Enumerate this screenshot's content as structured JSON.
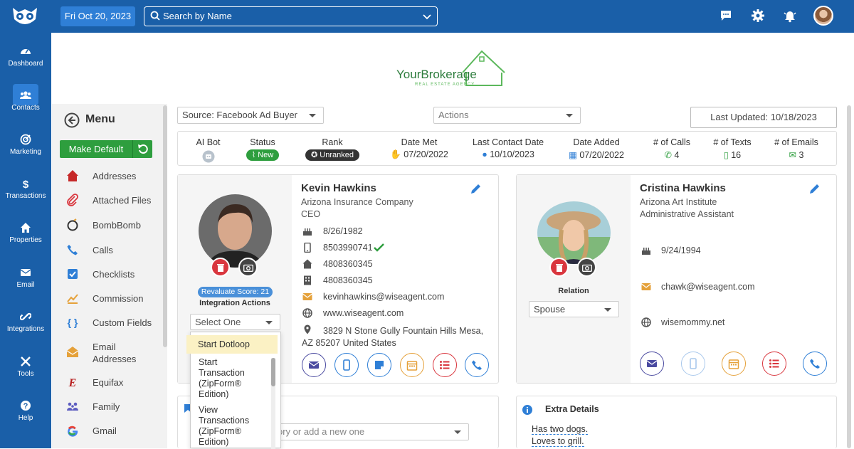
{
  "topbar": {
    "date": "Fri Oct 20, 2023",
    "search_placeholder": "Search by Name"
  },
  "nav": [
    {
      "label": "Dashboard",
      "icon": "gauge-icon"
    },
    {
      "label": "Contacts",
      "icon": "users-icon",
      "active": true
    },
    {
      "label": "Marketing",
      "icon": "marketing-icon"
    },
    {
      "label": "Transactions",
      "icon": "dollar-icon"
    },
    {
      "label": "Properties",
      "icon": "home-icon"
    },
    {
      "label": "Email",
      "icon": "envelope-icon"
    },
    {
      "label": "Integrations",
      "icon": "link-icon"
    },
    {
      "label": "Tools",
      "icon": "tools-icon"
    },
    {
      "label": "Help",
      "icon": "question-icon"
    }
  ],
  "brand": {
    "name": "YourBrokerage",
    "tagline": "REAL ESTATE AGENCY"
  },
  "menu": {
    "title": "Menu",
    "make_default": "Make Default",
    "items": [
      {
        "label": "Addresses",
        "icon": "house-icon"
      },
      {
        "label": "Attached Files",
        "icon": "paperclip-icon"
      },
      {
        "label": "BombBomb",
        "icon": "bombbomb-icon"
      },
      {
        "label": "Calls",
        "icon": "phone-icon"
      },
      {
        "label": "Checklists",
        "icon": "checkbox-icon"
      },
      {
        "label": "Commission",
        "icon": "chart-icon"
      },
      {
        "label": "Custom Fields",
        "icon": "braces-icon"
      },
      {
        "label": "Email Addresses",
        "line1": "Email",
        "line2": "Addresses",
        "icon": "envelope-open-icon"
      },
      {
        "label": "Equifax",
        "icon": "equifax-icon"
      },
      {
        "label": "Family",
        "icon": "family-icon"
      },
      {
        "label": "Gmail",
        "icon": "google-icon"
      }
    ]
  },
  "toolbar": {
    "source": "Source: Facebook Ad Buyer",
    "actions": "Actions",
    "last_updated": "Last Updated: 10/18/2023"
  },
  "stats": {
    "ai_bot": {
      "label": "AI Bot"
    },
    "status": {
      "label": "Status",
      "value": "New",
      "color": "#2e9e3e"
    },
    "rank": {
      "label": "Rank",
      "value": "Unranked",
      "color": "#333333"
    },
    "date_met": {
      "label": "Date Met",
      "value": "07/20/2022"
    },
    "last_contact": {
      "label": "Last Contact Date",
      "value": "10/10/2023"
    },
    "date_added": {
      "label": "Date Added",
      "value": "07/20/2022"
    },
    "calls": {
      "label": "# of Calls",
      "value": "4"
    },
    "texts": {
      "label": "# of Texts",
      "value": "16"
    },
    "emails": {
      "label": "# of Emails",
      "value": "3"
    }
  },
  "contact1": {
    "name": "Kevin Hawkins",
    "company": "Arizona Insurance Company",
    "title": "CEO",
    "birthday": "8/26/1982",
    "mobile": "8503990741",
    "home_phone": "4808360345",
    "office_phone": "4808360345",
    "email": "kevinhawkins@wiseagent.com",
    "website": "www.wiseagent.com",
    "address_line1": "3829 N Stone Gully Fountain Hills Mesa,",
    "address_line2": "AZ 85207 United States",
    "reevaluate": "Revaluate Score: 21",
    "integration_actions": "Integration Actions",
    "select_placeholder": "Select One"
  },
  "contact2": {
    "name": "Cristina Hawkins",
    "company": "Arizona Art Institute",
    "title": "Administrative Assistant",
    "birthday": "9/24/1994",
    "email": "chawk@wiseagent.com",
    "website": "wisemommy.net",
    "relation_label": "Relation",
    "relation_value": "Spouse"
  },
  "dropdown": {
    "items": [
      {
        "label": "Start Dotloop",
        "highlighted": true
      },
      {
        "label": "Start Transaction (ZipForm® Edition)",
        "lines": [
          "Start",
          "Transaction",
          "(ZipForm®",
          "Edition)"
        ]
      },
      {
        "label": "View Transactions (ZipForm® Edition)",
        "lines": [
          "View",
          "Transactions",
          "(ZipForm®",
          "Edition)"
        ]
      }
    ]
  },
  "category_select": "ory or add a new one",
  "extra_details": {
    "title": "Extra Details",
    "lines": [
      "Has two dogs.",
      "Loves to grill."
    ]
  },
  "colors": {
    "nav_bg": "#1a5fa8",
    "accent": "#2f7fd6",
    "green": "#2e9e3e",
    "red": "#d9363e",
    "orange": "#e5a13a",
    "purple": "#4a4aa0"
  }
}
